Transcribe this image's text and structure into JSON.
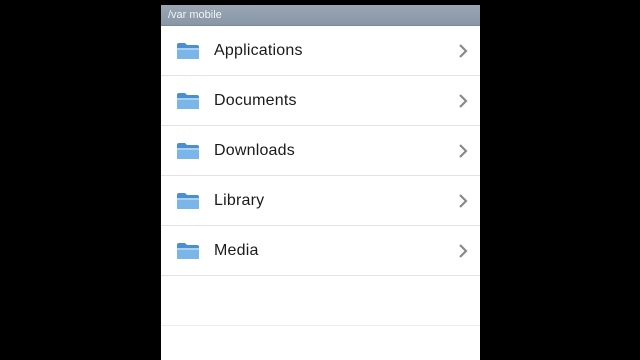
{
  "section_header": "/var mobile",
  "items": [
    {
      "label": "Applications",
      "icon": "folder-icon"
    },
    {
      "label": "Documents",
      "icon": "folder-icon"
    },
    {
      "label": "Downloads",
      "icon": "folder-icon"
    },
    {
      "label": "Library",
      "icon": "folder-icon"
    },
    {
      "label": "Media",
      "icon": "folder-icon"
    }
  ],
  "colors": {
    "background": "#000000",
    "header": "#909dad",
    "folder": "#5b9fd9",
    "chevron": "#8a8a8a"
  }
}
